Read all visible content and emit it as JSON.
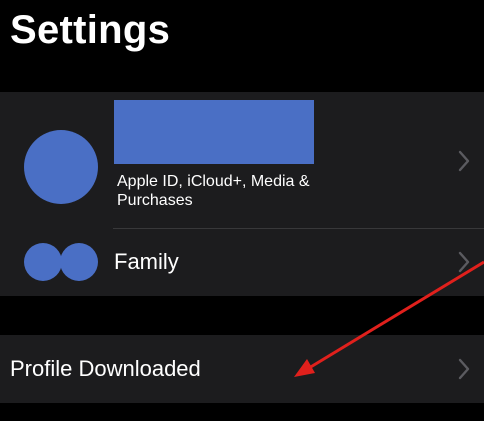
{
  "header": {
    "title": "Settings"
  },
  "account": {
    "subtitle": "Apple ID, iCloud+, Media & Purchases",
    "avatar_color": "#4a6fc5",
    "redaction_color": "#4a6fc5"
  },
  "family": {
    "label": "Family"
  },
  "profile": {
    "label": "Profile Downloaded"
  },
  "colors": {
    "background": "#000000",
    "group_background": "#1c1c1e",
    "separator": "#38383a",
    "chevron": "#5b5b60",
    "annotation_arrow": "#e0201c"
  },
  "icons": {
    "chevron": "chevron-right-icon",
    "family": "family-icon"
  }
}
